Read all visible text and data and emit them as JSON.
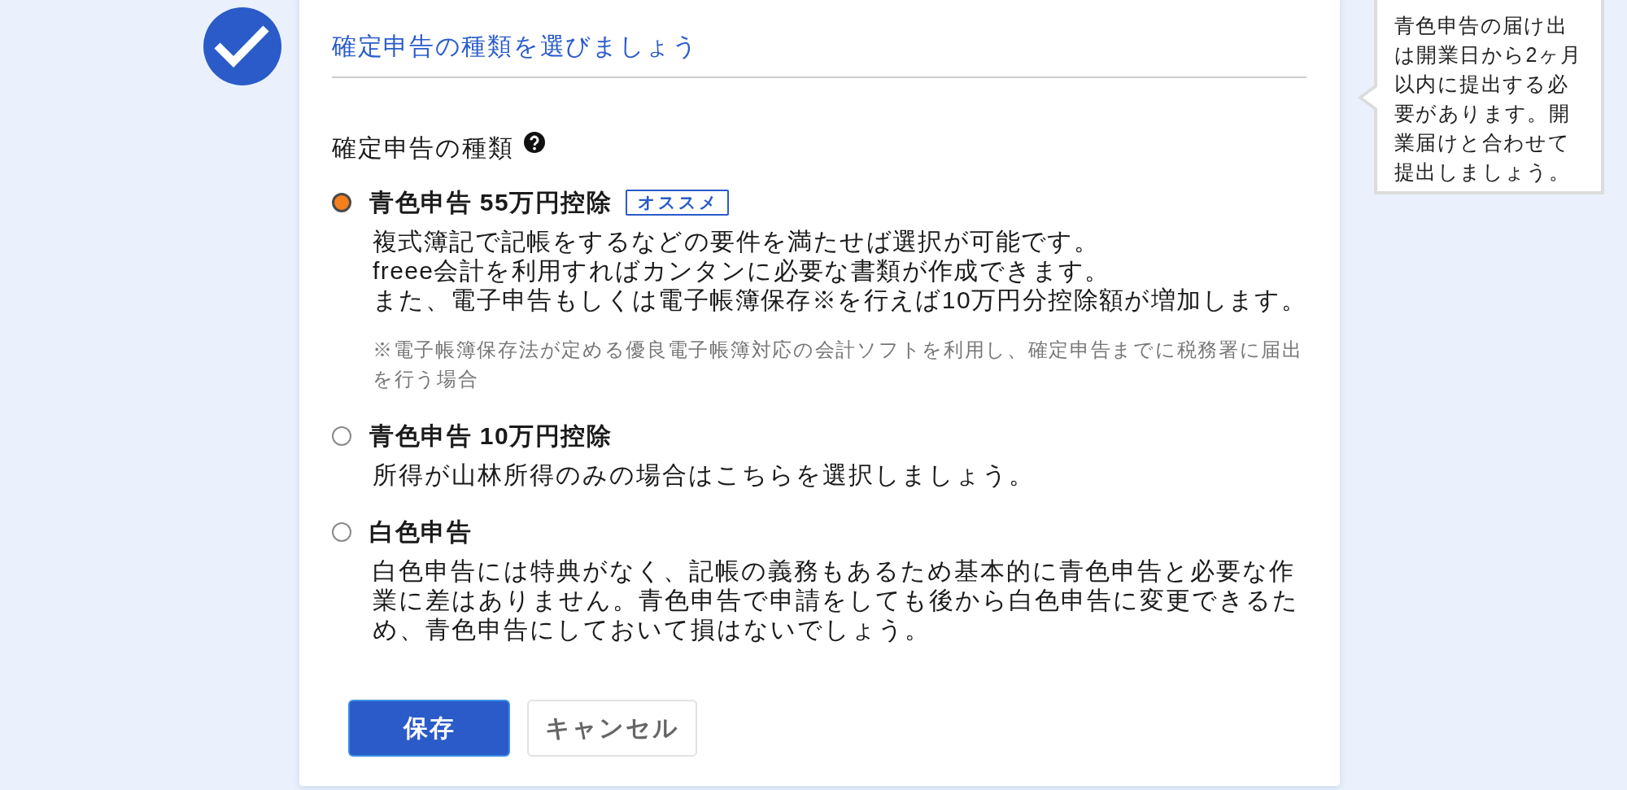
{
  "card": {
    "title": "確定申告の種類を選びましょう"
  },
  "field": {
    "label": "確定申告の種類",
    "options": [
      {
        "label": "青色申告 55万円控除",
        "badge": "オススメ",
        "selected": true,
        "description": [
          "複式簿記で記帳をするなどの要件を満たせば選択が可能です。",
          "freee会計を利用すればカンタンに必要な書類が作成できます。",
          "また、電子申告もしくは電子帳簿保存※を行えば10万円分控除額が増加します。"
        ],
        "note": "※電子帳簿保存法が定める優良電子帳簿対応の会計ソフトを利用し、確定申告までに税務署に届出を行う場合"
      },
      {
        "label": "青色申告 10万円控除",
        "selected": false,
        "description": [
          "所得が山林所得のみの場合はこちらを選択しましょう。"
        ]
      },
      {
        "label": "白色申告",
        "selected": false,
        "description": [
          "白色申告には特典がなく、記帳の義務もあるため基本的に青色申告と必要な作業に差はありません。青色申告で申請をしても後から白色申告に変更できるため、青色申告にしておいて損はないでしょう。"
        ]
      }
    ]
  },
  "buttons": [
    {
      "label": "保存",
      "kind": "primary"
    },
    {
      "label": "キャンセル",
      "kind": "secondary"
    }
  ],
  "tooltip": {
    "text": "青色申告の届け出は開業日から2ヶ月以内に提出する必要があります。開業届けと合わせて提出しましょう。"
  }
}
